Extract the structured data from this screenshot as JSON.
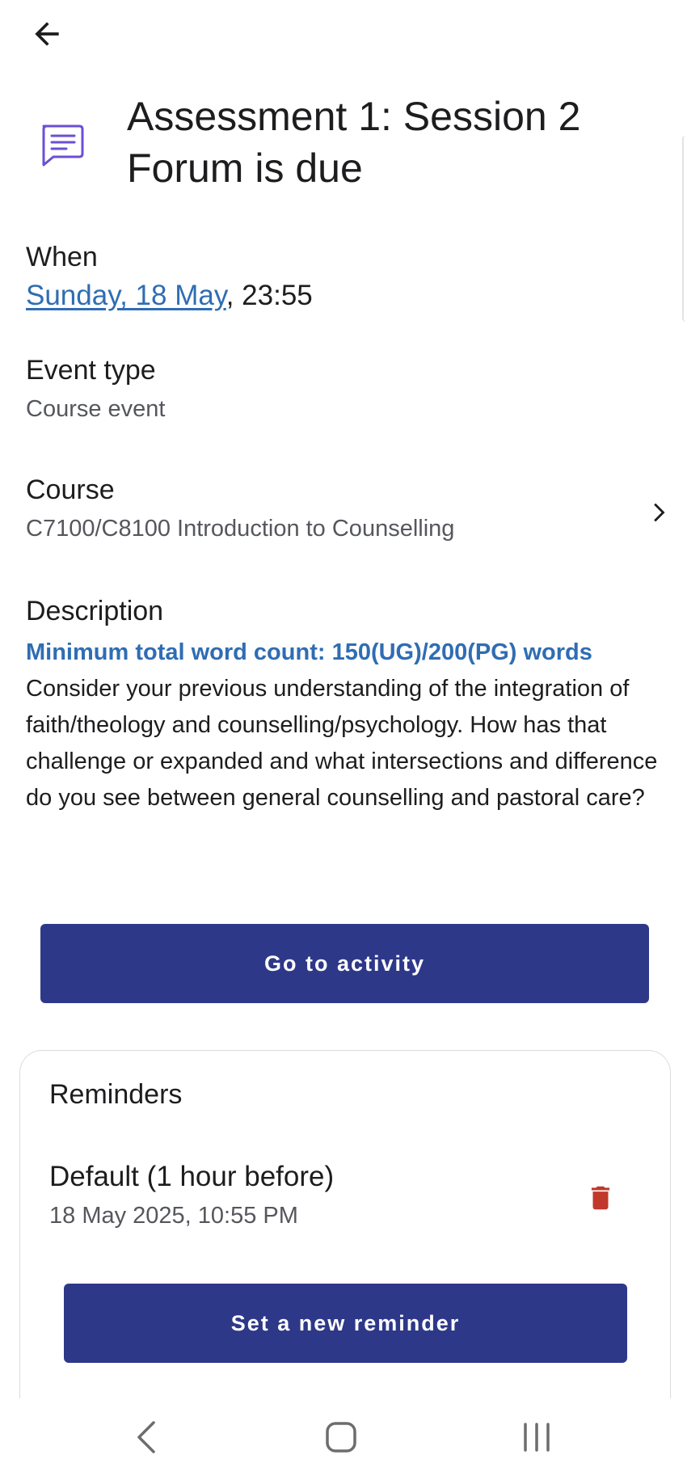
{
  "header": {
    "back_icon": "arrow-left-icon",
    "title": "Assessment 1: Session 2 Forum is due",
    "event_icon": "forum-message-icon",
    "accent_color": "#6b4fd6"
  },
  "when": {
    "label": "When",
    "date_link": "Sunday, 18 May",
    "time": ", 23:55"
  },
  "event_type": {
    "label": "Event type",
    "value": "Course event"
  },
  "course": {
    "label": "Course",
    "value": "C7100/C8100 Introduction to Counselling",
    "chevron_icon": "chevron-right-icon"
  },
  "description": {
    "label": "Description",
    "highlight": "Minimum total word count: 150(UG)/200(PG) words",
    "body": "Consider your previous understanding of the integration of faith/theology and counselling/psychology. How has that challenge or expanded and what intersections and difference do you see between general counselling and pastoral care?"
  },
  "actions": {
    "go_to_activity": "Go to activity",
    "button_color": "#2e3889"
  },
  "reminders": {
    "title": "Reminders",
    "items": [
      {
        "name": "Default (1 hour before)",
        "datetime": "18 May 2025, 10:55 PM",
        "delete_icon": "trash-icon"
      }
    ],
    "set_new_label": "Set a new reminder",
    "delete_color": "#c0392b"
  },
  "system_nav": {
    "back_icon": "nav-back-icon",
    "home_icon": "nav-home-icon",
    "recents_icon": "nav-recents-icon"
  }
}
